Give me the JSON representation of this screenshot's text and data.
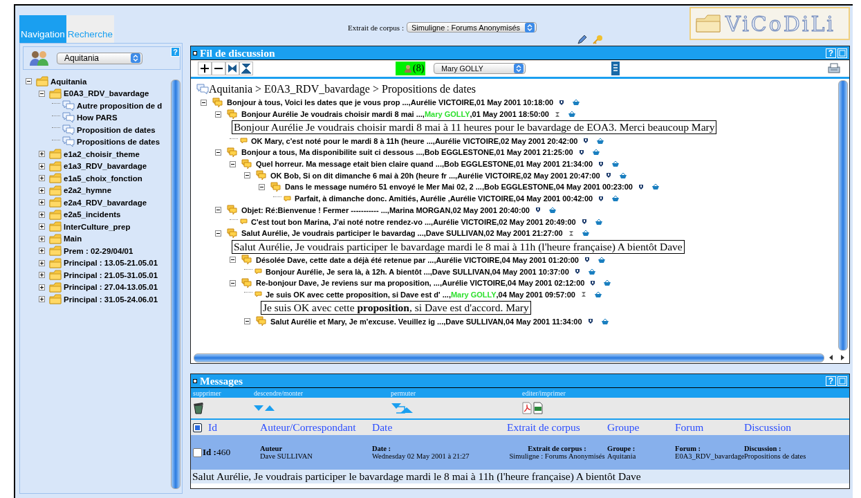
{
  "tabs": [
    {
      "label": "Navigation",
      "selected": true
    },
    {
      "label": "Recherche",
      "selected": false
    }
  ],
  "group_selector": {
    "value": "Aquitania",
    "help": "?"
  },
  "tree": [
    {
      "label": "Aquitania",
      "kind": "folder",
      "expanded": true,
      "children": [
        {
          "label": "E0A3_RDV_bavardage",
          "kind": "folder",
          "expanded": true,
          "children": [
            {
              "label": "Autre proposition de d",
              "kind": "discussion"
            },
            {
              "label": "How PARS",
              "kind": "discussion"
            },
            {
              "label": "Proposition de dates",
              "kind": "discussion"
            },
            {
              "label": "Propositions de dates",
              "kind": "discussion"
            }
          ]
        },
        {
          "label": "e1a2_choisir_theme",
          "kind": "folder",
          "expanded": false
        },
        {
          "label": "e1a3_RDV_bavardage",
          "kind": "folder",
          "expanded": false
        },
        {
          "label": "e1a5_choix_fonction",
          "kind": "folder",
          "expanded": false
        },
        {
          "label": "e2a2_hymne",
          "kind": "folder",
          "expanded": false
        },
        {
          "label": "e2a4_RDV_bavardage",
          "kind": "folder",
          "expanded": false
        },
        {
          "label": "e2a5_incidents",
          "kind": "folder",
          "expanded": false
        },
        {
          "label": "InterCulture_prep",
          "kind": "folder",
          "expanded": false
        },
        {
          "label": "Main",
          "kind": "folder",
          "expanded": false
        },
        {
          "label": "Prem : 02-29/04/01",
          "kind": "folder",
          "expanded": false
        },
        {
          "label": "Principal : 13.05-21.05.01",
          "kind": "folder",
          "expanded": false
        },
        {
          "label": "Principal : 21.05-31.05.01",
          "kind": "folder",
          "expanded": false
        },
        {
          "label": "Principal : 27.04-13.05.01",
          "kind": "folder",
          "expanded": false
        },
        {
          "label": "Principal : 31.05-24.06.01",
          "kind": "folder",
          "expanded": false
        }
      ]
    }
  ],
  "corpus": {
    "label": "Extrait de corpus :",
    "value": "Simuligne : Forums Anonymisés"
  },
  "logo": {
    "text": "ViCoDiLi"
  },
  "thread_panel": {
    "title": "Fil de discussion",
    "help": "?",
    "participants_count": "(8)",
    "participant": "Mary GOLLY",
    "breadcrumb": "Aquitania > E0A3_RDV_bavardage > Propositions de dates",
    "messages": [
      {
        "subject": "Bonjour à tous, Voici les dates que je vous prop ...,",
        "author": "Aurélie VICTOIRE",
        "date": ",01 May 2001 10:18:00",
        "color": "#000000",
        "kind": "pin",
        "expanded": true,
        "children": [
          {
            "subject": "Bonjour Aurélie Je voudrais choisir mardi 8 mai ...,",
            "author": "Mary GOLLY",
            "date": ",01 May 2001 18:50:00",
            "color": "#2ee02e",
            "kind": "hourglass",
            "expanded": true,
            "body": "Bonjour Aurélie Je voudrais choisir mardi 8 mai à 11 heures pour le bavardage de EOA3. Merci beaucoup Mary",
            "children": [
              {
                "subject": "OK Mary, c'est noté pour le mardi 8 à 11h (heure ...,",
                "author": "Aurélie VICTOIRE",
                "date": ",02 May 2001 20:42:00",
                "color": "#000000",
                "kind": "pin"
              }
            ]
          },
          {
            "subject": "Bonjour a tous, Ma disponibilite suit ci dessous ...,",
            "author": "Bob EGGLESTONE",
            "date": ",01 May 2001 21:25:00",
            "color": "#000000",
            "kind": "pin",
            "expanded": true,
            "children": [
              {
                "subject": "Quel horreur. Ma message etait bien claire quand ...,",
                "author": "Bob EGGLESTONE",
                "date": ",01 May 2001 21:34:00",
                "color": "#000000",
                "kind": "pin",
                "expanded": true,
                "children": [
                  {
                    "subject": "OK Bob, Si on dit dimanche 6 mai à 20h (heure fr ...,",
                    "author": "Aurélie VICTOIRE",
                    "date": ",02 May 2001 20:47:00",
                    "color": "#000000",
                    "kind": "pin",
                    "expanded": true,
                    "children": [
                      {
                        "subject": "Dans le message numéro 51 envoyé le Mer Mai 02, 2 ...,",
                        "author": "Bob EGGLESTONE",
                        "date": ",04 May 2001 00:23:00",
                        "color": "#000000",
                        "kind": "pin",
                        "expanded": true,
                        "children": [
                          {
                            "subject": "Parfait, à dimanche donc. Amitiés, Aurélie ,",
                            "author": "Aurélie VICTOIRE",
                            "date": ",04 May 2001 00:42:00",
                            "color": "#000000",
                            "kind": "pin"
                          }
                        ]
                      }
                    ]
                  }
                ]
              }
            ]
          },
          {
            "subject": "Objet: Ré:Bienvenue ! Fermer ----------- ...,",
            "author": "Marina MORGAN",
            "date": ",02 May 2001 20:40:00",
            "color": "#000000",
            "kind": "pin",
            "expanded": true,
            "children": [
              {
                "subject": "C'est tout bon Marina, J'ai noté notre rendez-vo ...,",
                "author": "Aurélie VICTOIRE",
                "date": ",02 May 2001 20:49:00",
                "color": "#000000",
                "kind": "pin"
              }
            ]
          },
          {
            "subject": "Salut Aurélie, Je voudrais participer le bavardag ...,",
            "author": "Dave SULLIVAN",
            "date": ",02 May 2001 21:27:00",
            "color": "#000000",
            "kind": "hourglass",
            "expanded": true,
            "body": "Salut Aurélie, Je voudrais participer le bavardage mardi le 8 mai à 11h (l'heure française) A bientôt Dave",
            "children": [
              {
                "subject": "Désolée Dave, cette date a déjà été retenue par ...,",
                "author": "Aurélie VICTOIRE",
                "date": ",04 May 2001 01:20:00",
                "color": "#000000",
                "kind": "pin",
                "expanded": true,
                "children": [
                  {
                    "subject": "Bonjour Aurélie, Je sera là, à 12h. A bientôt ...,",
                    "author": "Dave SULLIVAN",
                    "date": ",04 May 2001 10:37:00",
                    "color": "#000000",
                    "kind": "pin"
                  }
                ]
              },
              {
                "subject": "Re-bonjour Dave, Je reviens sur ma proposition, ...,",
                "author": "Aurélie VICTOIRE",
                "date": ",04 May 2001 02:12:00",
                "color": "#000000",
                "kind": "pin",
                "expanded": true,
                "children": [
                  {
                    "subject": "Je suis OK avec cette proposition, si Dave est d' ...,",
                    "author": "Mary GOLLY",
                    "date": ",04 May 2001 09:57:00",
                    "color": "#2ee02e",
                    "kind": "hourglass",
                    "body": "Je suis OK avec cette **proposition**, si Dave est d'accord. Mary"
                  },
                  {
                    "subject": "Salut Aurélie et Mary, Je m'excuse. Veuillez ig ...,",
                    "author": "Dave SULLIVAN",
                    "date": ",04 May 2001 11:34:00",
                    "color": "#000000",
                    "kind": "pin",
                    "expanded": true
                  }
                ]
              }
            ]
          }
        ]
      }
    ]
  },
  "messages_panel": {
    "title": "Messages",
    "help": "?",
    "actions": [
      {
        "label": "supprimer",
        "kind": "delete"
      },
      {
        "label": "descendre/monter",
        "kind": "move"
      },
      {
        "label": "permuter",
        "kind": "swap"
      },
      {
        "label": "editer/imprimer",
        "kind": "export"
      }
    ],
    "header_checked": true,
    "columns": [
      "Id",
      "Auteur/Correspondant",
      "Date",
      "Extrait de corpus",
      "Groupe",
      "Forum",
      "Discussion"
    ],
    "rows": [
      {
        "checked": false,
        "id_label": "Id :",
        "id": "460",
        "fields": [
          {
            "label": "Auteur",
            "value": "Dave SULLIVAN"
          },
          {
            "label": "Date :",
            "value": "Wednesday 02 May 2001 à 21:27"
          },
          {
            "label": "Extrait de corpus :",
            "value": "Simuligne : Forums Anonymisés"
          },
          {
            "label": "Groupe :",
            "value": "Aquitania"
          },
          {
            "label": "Forum :",
            "value": "E0A3_RDV_bavardage"
          },
          {
            "label": "Discussion :",
            "value": "Propositions de dates"
          }
        ]
      }
    ],
    "body": "Salut Aurélie, Je voudrais participer le bavardage mardi le 8 mai à 11h (l'heure française) A bientôt Dave"
  }
}
